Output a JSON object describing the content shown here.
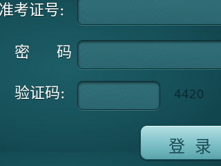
{
  "form": {
    "exam_id_label": "准考证号:",
    "exam_id_value": "",
    "password_label": "密 码:",
    "password_value": "",
    "captcha_label": "验证码:",
    "captcha_value": "",
    "captcha_code": "4420",
    "login_label": "登录"
  }
}
